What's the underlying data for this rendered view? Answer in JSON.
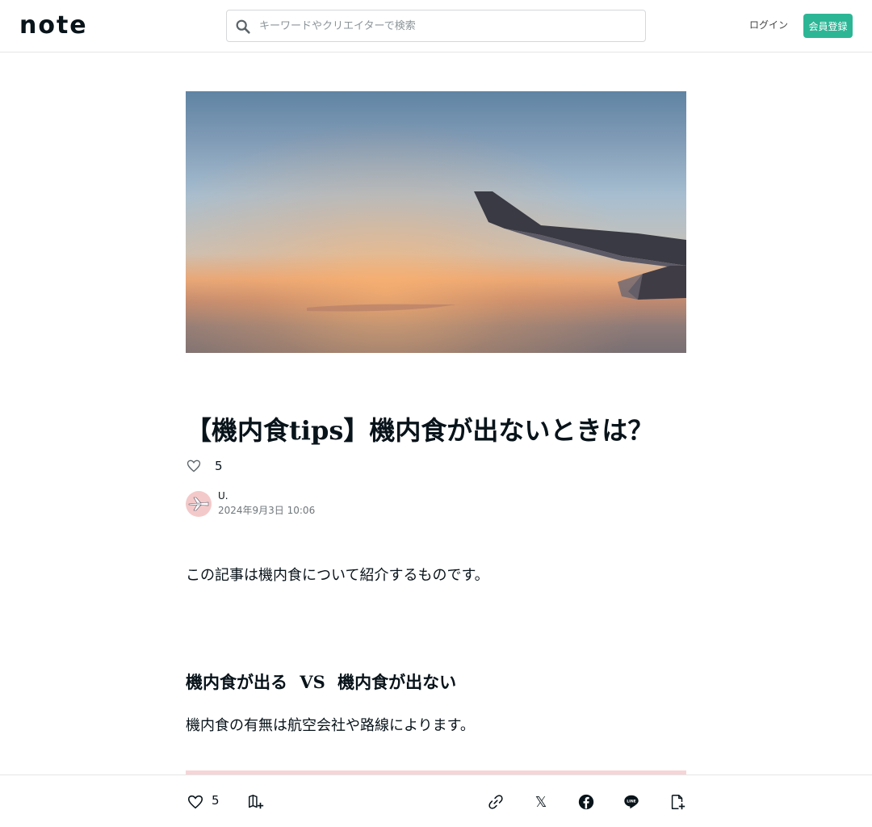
{
  "header": {
    "logo": "note",
    "search_placeholder": "キーワードやクリエイターで検索",
    "login_label": "ログイン",
    "signup_label": "会員登録"
  },
  "article": {
    "title": "【機内食tips】機内食が出ないときは？",
    "like_count": "5",
    "author_name": "U.",
    "published_at": "2024年9月3日 10:06",
    "paragraph_1": "この記事は機内食について紹介するものです。",
    "heading_2": "機内食が出る VS 機内食が出ない",
    "paragraph_2": "機内食の有無は航空会社や路線によります。"
  },
  "bottom_bar": {
    "like_count": "5",
    "icons": [
      "heart-icon",
      "magazine-add-icon",
      "link-icon",
      "x-icon",
      "facebook-icon",
      "line-icon",
      "note-add-icon"
    ],
    "x_label": "𝕏"
  },
  "colors": {
    "accent": "#2cb696",
    "text": "#08131a",
    "border": "#e6e6e6",
    "pink": "#f7d4d6"
  }
}
